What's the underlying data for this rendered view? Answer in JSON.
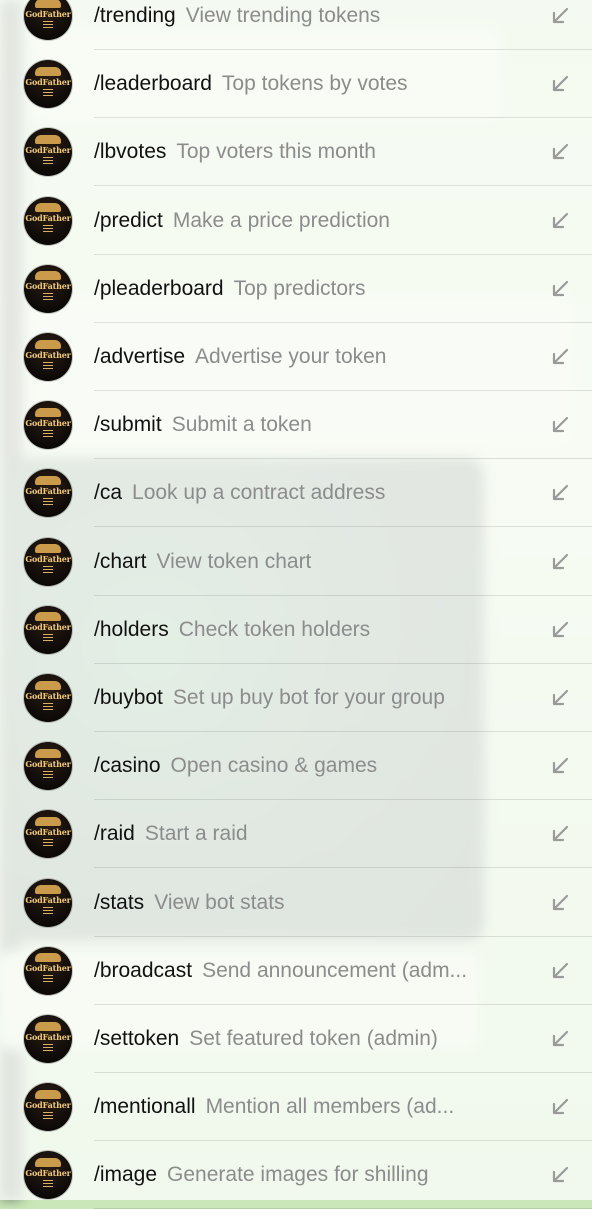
{
  "app": {
    "bot_avatar_text": "GodFather"
  },
  "commands": [
    {
      "command": "/trending",
      "description": "View trending tokens"
    },
    {
      "command": "/leaderboard",
      "description": "Top tokens by votes"
    },
    {
      "command": "/lbvotes",
      "description": "Top voters this month"
    },
    {
      "command": "/predict",
      "description": "Make a price prediction"
    },
    {
      "command": "/pleaderboard",
      "description": "Top predictors"
    },
    {
      "command": "/advertise",
      "description": "Advertise your token"
    },
    {
      "command": "/submit",
      "description": "Submit a token"
    },
    {
      "command": "/ca",
      "description": "Look up a contract address"
    },
    {
      "command": "/chart",
      "description": "View token chart"
    },
    {
      "command": "/holders",
      "description": "Check token holders"
    },
    {
      "command": "/buybot",
      "description": "Set up buy bot for your group"
    },
    {
      "command": "/casino",
      "description": "Open casino & games"
    },
    {
      "command": "/raid",
      "description": "Start a raid"
    },
    {
      "command": "/stats",
      "description": "View bot stats"
    },
    {
      "command": "/broadcast",
      "description": "Send announcement (adm..."
    },
    {
      "command": "/settoken",
      "description": "Set featured token (admin)"
    },
    {
      "command": "/mentionall",
      "description": "Mention all members (ad..."
    },
    {
      "command": "/image",
      "description": "Generate images for shilling"
    }
  ],
  "icons": {
    "insert": "arrow-down-left-icon"
  },
  "colors": {
    "command_text": "#111111",
    "description_text": "#8c8c8c",
    "chat_background": "#c9e7b8"
  }
}
